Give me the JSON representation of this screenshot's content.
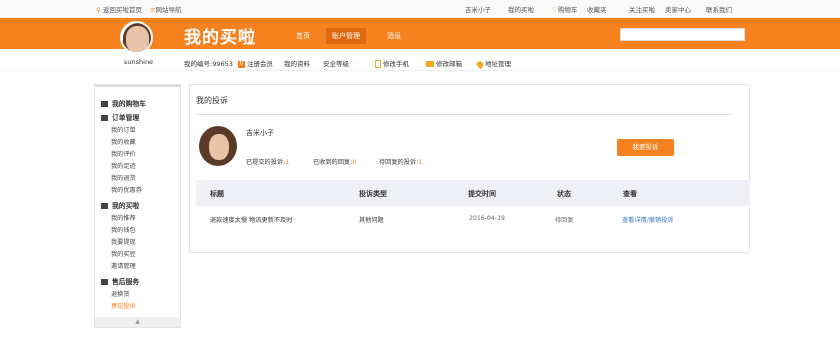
{
  "topbar": {
    "home": "返回买啦首页",
    "site_nav": "网站导航",
    "user": "吉米小子",
    "my_buy": "我的买啦",
    "cart": "购物车",
    "favorites": "收藏夹",
    "follow": "关注买啦",
    "seller": "卖家中心",
    "contact": "联系我们"
  },
  "header": {
    "brand": "我的买啦",
    "nav": [
      "首页",
      "账户管理",
      "消息"
    ],
    "username": "sunshine"
  },
  "subnav": {
    "account_label": "我的编号:",
    "account_id": "99653",
    "member": "注册会员",
    "profile": "我的资料",
    "security_label": "安全等级:",
    "phone": "修改手机",
    "email": "修改邮箱",
    "address": "地址管理"
  },
  "sidebar": {
    "sections": [
      {
        "title": "我的购物车",
        "items": []
      },
      {
        "title": "订单管理",
        "items": [
          "我的订单",
          "我的收藏",
          "我的评价",
          "我的足迹",
          "我的退货",
          "我的优惠券"
        ]
      },
      {
        "title": "我的买啦",
        "items": [
          "我的推荐",
          "我的钱包",
          "我要提现",
          "我的买豆",
          "邀请管理"
        ]
      },
      {
        "title": "售后服务",
        "items": [
          "退换货",
          "意见投诉"
        ]
      }
    ],
    "scroll": "▲"
  },
  "content": {
    "title": "我的投诉",
    "user_name": "吉米小子",
    "stats": [
      {
        "label": "已提交的投诉:",
        "value": "1"
      },
      {
        "label": "已收到的回复:",
        "value": "0"
      },
      {
        "label": "待回复的投诉:",
        "value": "1"
      }
    ],
    "button": "我要投诉",
    "table": {
      "headers": [
        "标题",
        "投诉类型",
        "提交时间",
        "状态",
        "查看"
      ],
      "rows": [
        [
          "退款速度太慢 物流更新不及时",
          "其他问题",
          "2016-04-19",
          "待回复",
          "查看详情/撤销投诉"
        ]
      ]
    }
  },
  "colors": {
    "accent": "#f5821f"
  }
}
